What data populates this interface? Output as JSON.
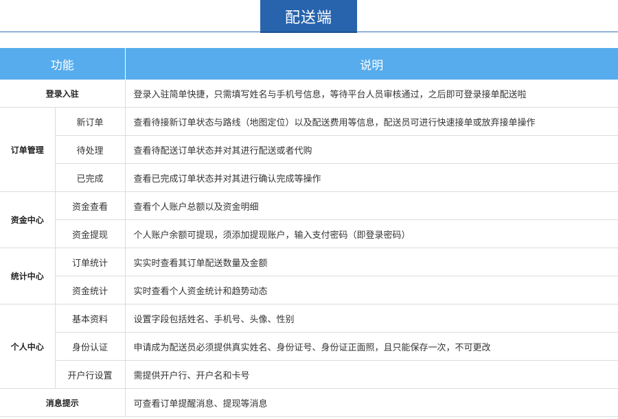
{
  "header": {
    "title": "配送端"
  },
  "table": {
    "headers": {
      "feature": "功能",
      "description": "说明"
    },
    "login": {
      "label": "登录入驻",
      "desc": "登录入驻简单快捷，只需填写姓名与手机号信息，等待平台人员审核通过，之后即可登录接单配送啦"
    },
    "order": {
      "label": "订单管理",
      "items": [
        {
          "label": "新订单",
          "desc": "查看待接新订单状态与路线（地图定位）以及配送费用等信息，配送员可进行快速接单或放弃接单操作"
        },
        {
          "label": "待处理",
          "desc": "查看待配送订单状态并对其进行配送或者代购"
        },
        {
          "label": "已完成",
          "desc": "查看已完成订单状态并对其进行确认完成等操作"
        }
      ]
    },
    "funds": {
      "label": "资金中心",
      "items": [
        {
          "label": "资金查看",
          "desc": "查看个人账户总额以及资金明细"
        },
        {
          "label": "资金提现",
          "desc": "个人账户余额可提现，须添加提现账户，输入支付密码（即登录密码）"
        }
      ]
    },
    "stats": {
      "label": "统计中心",
      "items": [
        {
          "label": "订单统计",
          "desc": "实实时查看其订单配送数量及金额"
        },
        {
          "label": "资金统计",
          "desc": "实时查看个人资金统计和趋势动态"
        }
      ]
    },
    "personal": {
      "label": "个人中心",
      "items": [
        {
          "label": "基本资料",
          "desc": "设置字段包括姓名、手机号、头像、性别"
        },
        {
          "label": "身份认证",
          "desc": "申请成为配送员必须提供真实姓名、身份证号、身份证正面照，且只能保存一次，不可更改"
        },
        {
          "label": "开户行设置",
          "desc": "需提供开户行、开户名和卡号"
        }
      ]
    },
    "messages": {
      "label": "消息提示",
      "desc": "可查看订单提醒消息、提现等消息"
    }
  }
}
